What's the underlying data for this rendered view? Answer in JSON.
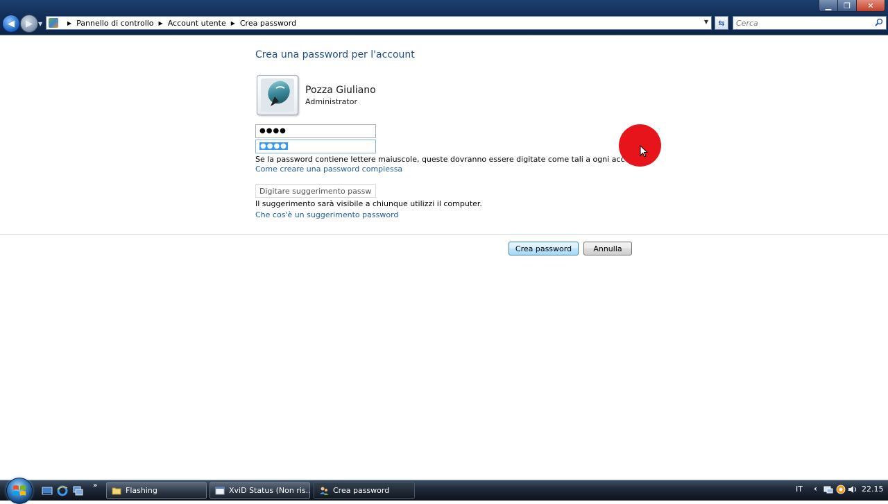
{
  "window": {
    "minimize_glyph": "▁",
    "maximize_glyph": "❐",
    "close_glyph": "✕"
  },
  "address_bar": {
    "breadcrumbs": [
      "Pannello di controllo",
      "Account utente",
      "Crea password"
    ]
  },
  "search": {
    "placeholder": "Cerca"
  },
  "page": {
    "title": "Crea una password per l'account",
    "user": {
      "name": "Pozza Giuliano",
      "role": "Administrator"
    },
    "password_mask": "●●●●",
    "confirm_mask": "●●●●",
    "caps_note": "Se la password contiene lettere maiuscole, queste dovranno essere digitate come tali a ogni accesso.",
    "strong_password_link": "Come creare una password complessa",
    "hint_placeholder": "Digitare suggerimento password",
    "hint_note": "Il suggerimento sarà visibile a chiunque utilizzi il computer.",
    "hint_link": "Che cos'è un suggerimento password",
    "create_button": "Crea password",
    "cancel_button": "Annulla"
  },
  "taskbar": {
    "overflow_glyph": "»",
    "tasks": [
      "Flashing",
      "XviD Status (Non ris...",
      "Crea password"
    ],
    "language": "IT",
    "tray_chevron": "‹",
    "clock": "22.15"
  },
  "colors": {
    "title_text": "#1e4e8c",
    "link": "#1c5fab",
    "cursor_highlight": "#e8141b"
  }
}
